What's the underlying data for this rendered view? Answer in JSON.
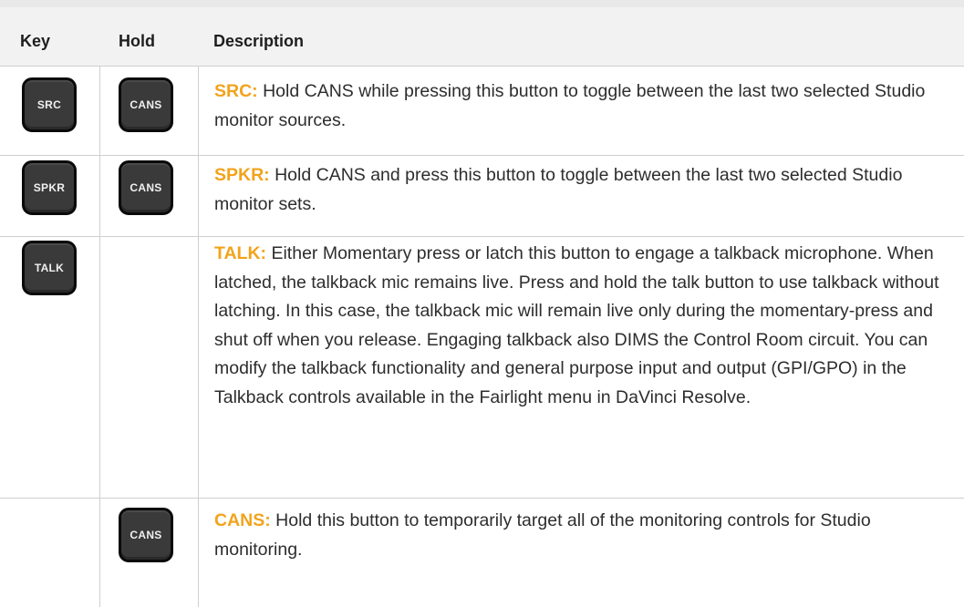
{
  "table": {
    "headers": {
      "key": "Key",
      "hold": "Hold",
      "description": "Description"
    },
    "rows": [
      {
        "key": "SRC",
        "hold": "CANS",
        "term": "SRC:",
        "text": " Hold CANS while pressing this button to toggle between the last two selected Studio monitor sources."
      },
      {
        "key": "SPKR",
        "hold": "CANS",
        "term": "SPKR:",
        "text": " Hold CANS and press this button to toggle between the last two selected Studio monitor sets."
      },
      {
        "key": "TALK",
        "hold": "",
        "term": "TALK:",
        "text": " Either Momentary press or latch this button to engage a talkback microphone. When latched, the talkback mic remains live. Press and hold the talk button to use talkback without latching. In this case, the talkback mic will remain live only during the momentary-press and shut off when you release. Engaging talkback also DIMS the Control Room circuit. You can modify the talkback functionality and general purpose input and output (GPI/GPO) in the Talkback controls available in the Fairlight menu in DaVinci Resolve."
      },
      {
        "key": "",
        "hold": "CANS",
        "term": "CANS:",
        "text": " Hold this button to temporarily target all of the monitoring controls for Studio monitoring."
      }
    ]
  },
  "colors": {
    "accent": "#f2a31c",
    "keycap": "#3a3a3a",
    "header_bg": "#f2f2f2",
    "grid": "#cfcfcf"
  }
}
